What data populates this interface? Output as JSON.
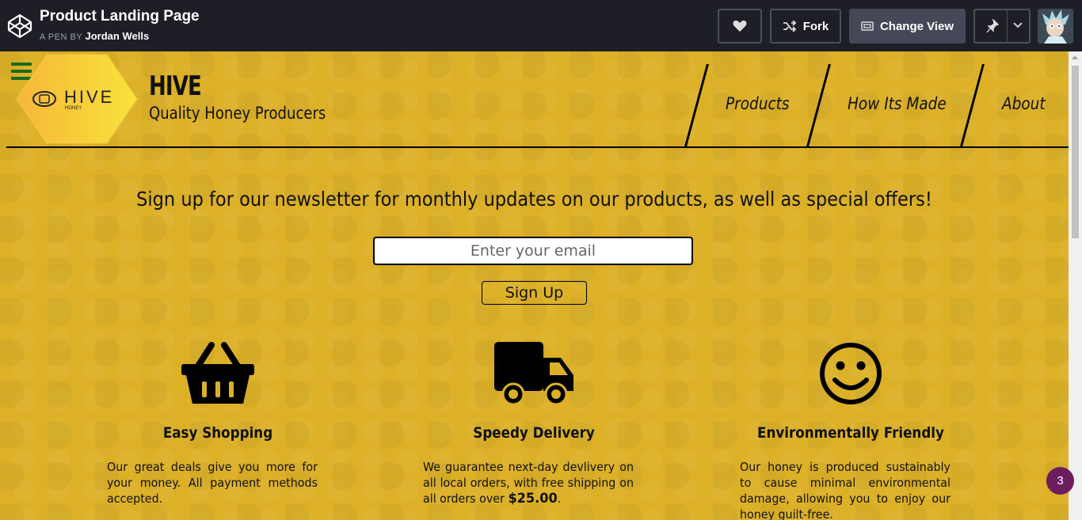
{
  "codepen": {
    "title": "Product Landing Page",
    "by_prefix": "A PEN BY",
    "author": "Jordan Wells",
    "fork_label": "Fork",
    "change_view_label": "Change View"
  },
  "site": {
    "brand": "HIVE",
    "logo_text": "HIVE",
    "logo_subtext": "HONEY",
    "tagline": "Quality Honey Producers",
    "nav": [
      "Products",
      "How Its Made",
      "About"
    ],
    "newsletter_text": "Sign up for our newsletter for monthly updates on our products, as well as special offers!",
    "email_placeholder": "Enter your email",
    "signup_label": "Sign Up",
    "features": [
      {
        "icon": "shopping-basket-icon",
        "title": "Easy Shopping",
        "text": "Our great deals give you more for your money. All payment methods accepted."
      },
      {
        "icon": "truck-icon",
        "title": "Speedy Delivery",
        "text_before": "We guarantee next-day devlivery on all local orders, with free shipping on all orders over ",
        "text_bold": "$25.00",
        "text_after": "."
      },
      {
        "icon": "smiley-icon",
        "title": "Environmentally Friendly",
        "text": "Our honey is produced sustainably to cause minimal environmental damage, allowing you to enjoy our honey guilt-free."
      }
    ]
  },
  "notification_count": "3",
  "colors": {
    "page_bg": "#dcb027",
    "topbar_bg": "#1e1f26",
    "badge": "#6b1d5e",
    "hamburger": "#1b6a1b"
  }
}
